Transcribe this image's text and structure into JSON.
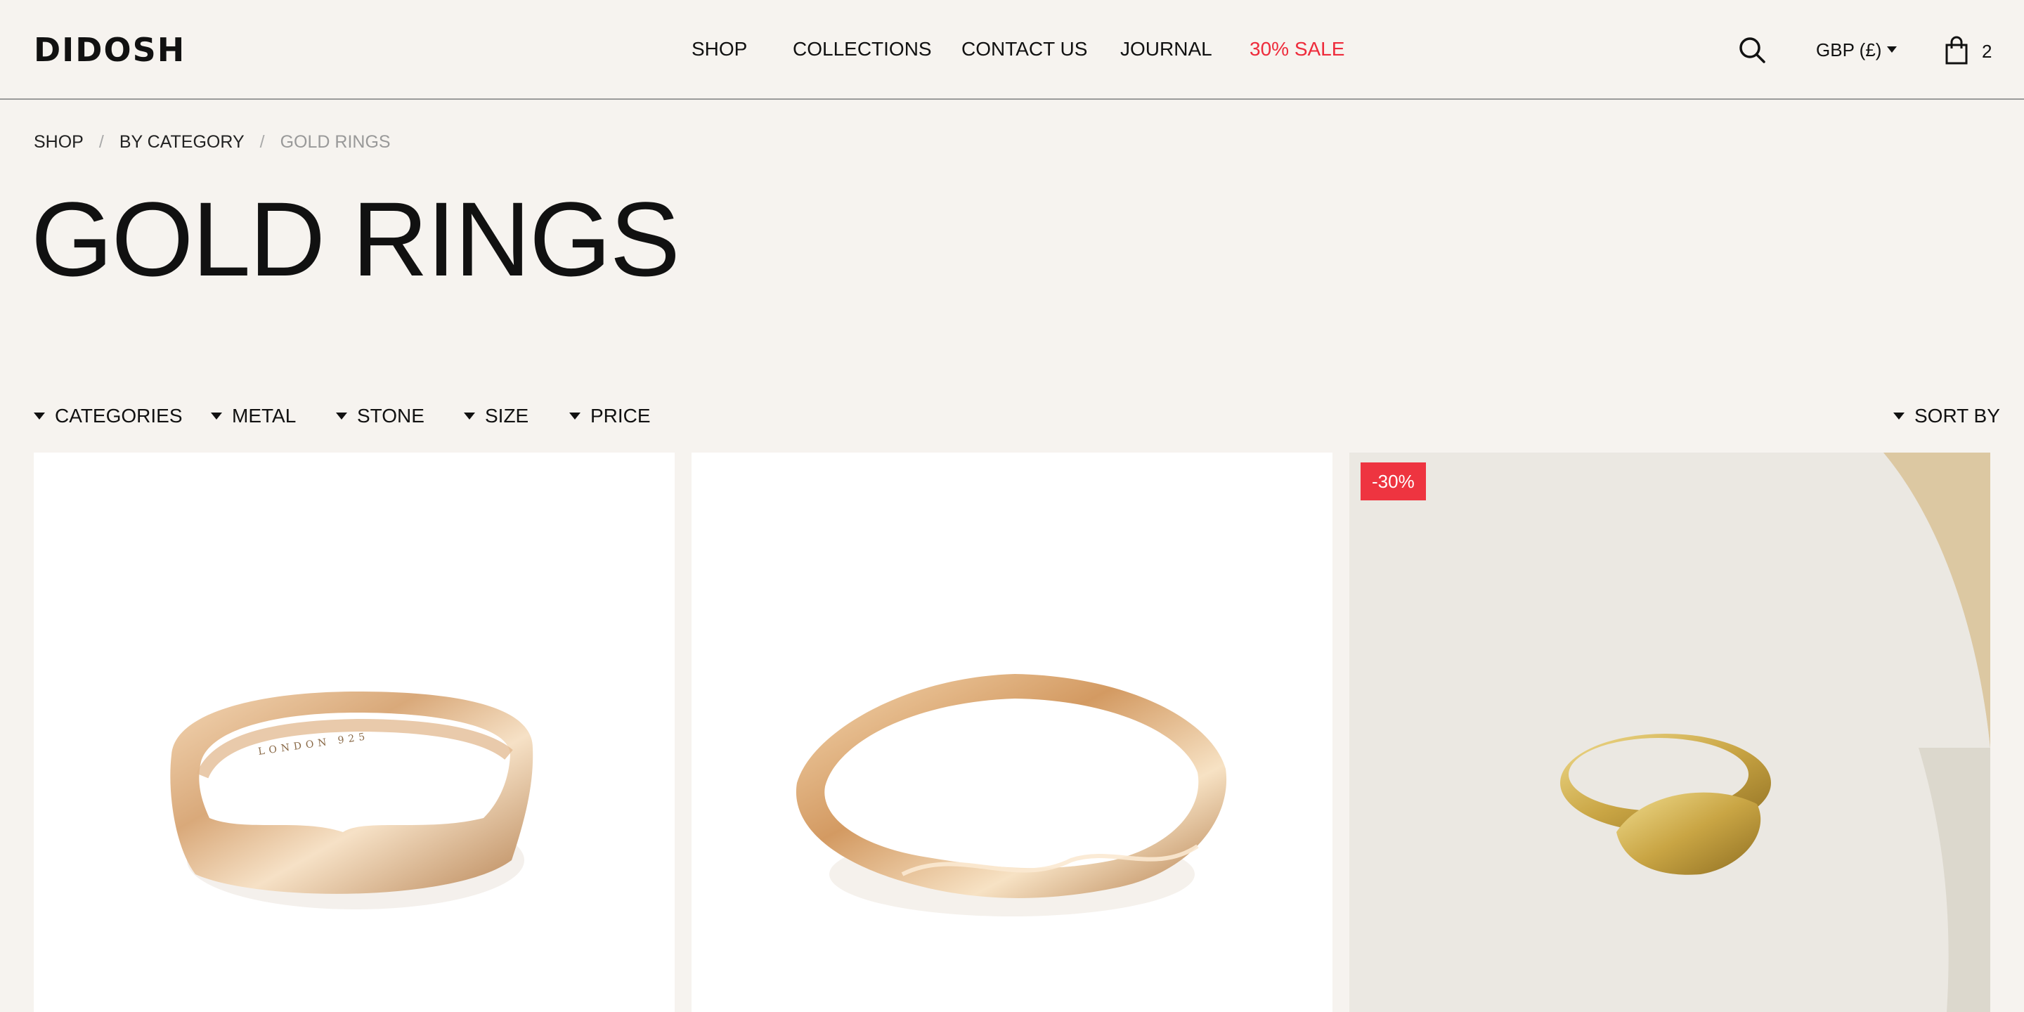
{
  "header": {
    "logo": "DIDOSH",
    "nav": [
      "SHOP",
      "COLLECTIONS",
      "CONTACT US",
      "JOURNAL",
      "30% SALE"
    ],
    "currency": "GBP (£)",
    "cart_count": "2",
    "sale_color": "#ee2b3b"
  },
  "breadcrumb": [
    "SHOP",
    "BY CATEGORY",
    "GOLD RINGS"
  ],
  "page_title": "GOLD RINGS",
  "filters": [
    "CATEGORIES",
    "METAL",
    "STONE",
    "SIZE",
    "PRICE"
  ],
  "sort_label": "SORT BY",
  "products": [
    {
      "image": "gold-wave-ring-engraved",
      "badge": ""
    },
    {
      "image": "gold-molten-ring",
      "badge": ""
    },
    {
      "image": "gold-signet-ring-on-marble",
      "badge": "-30%"
    }
  ],
  "colors": {
    "background": "#f6f3ef",
    "badge": "#ee3440"
  }
}
